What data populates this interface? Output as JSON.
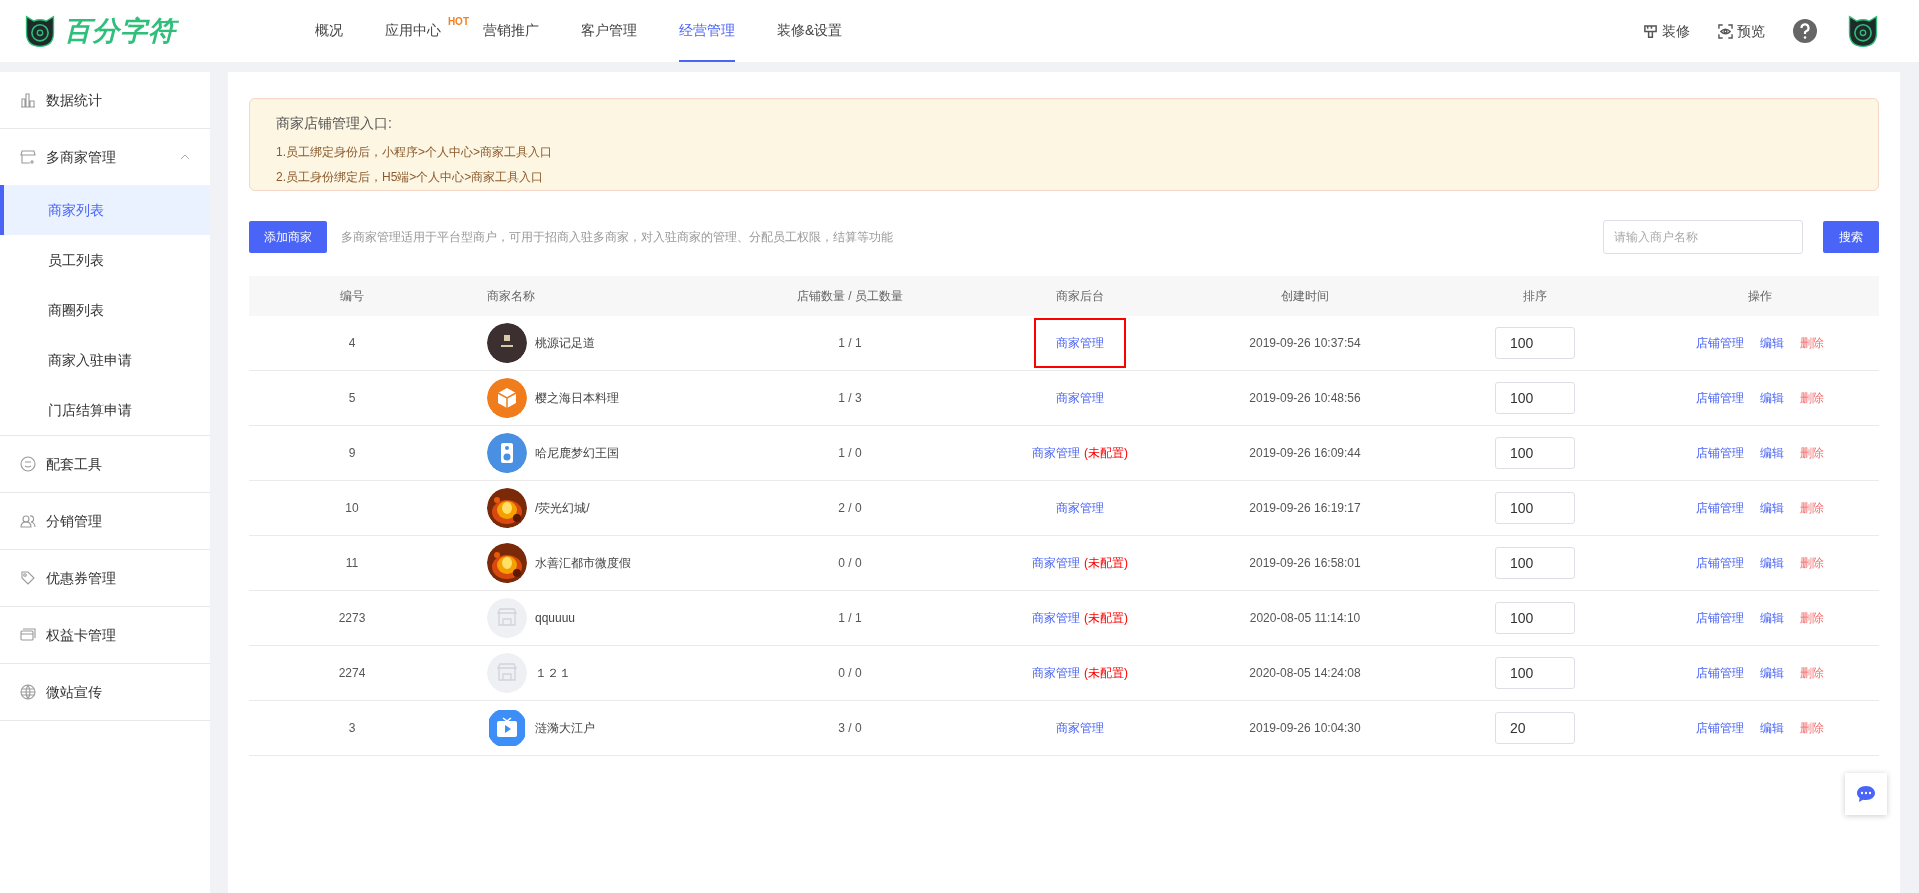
{
  "header": {
    "logo_text": "百分字符",
    "nav": [
      {
        "label": "概况",
        "selected": false
      },
      {
        "label": "应用中心",
        "badge": "HOT",
        "selected": false
      },
      {
        "label": "营销推广",
        "selected": false
      },
      {
        "label": "客户管理",
        "selected": false
      },
      {
        "label": "经营管理",
        "selected": true
      },
      {
        "label": "装修&设置",
        "selected": false
      }
    ],
    "actions": [
      {
        "kind": "decorate",
        "label": "装修"
      },
      {
        "kind": "preview",
        "label": "预览"
      }
    ]
  },
  "sidebar": {
    "items": [
      {
        "kind": "chart",
        "label": "数据统计"
      },
      {
        "kind": "store",
        "label": "多商家管理",
        "expanded": true,
        "children": [
          {
            "label": "商家列表",
            "selected": true
          },
          {
            "label": "员工列表",
            "selected": false
          },
          {
            "label": "商圈列表",
            "selected": false
          },
          {
            "label": "商家入驻申请",
            "selected": false
          },
          {
            "label": "门店结算申请",
            "selected": false
          }
        ]
      },
      {
        "kind": "smile",
        "label": "配套工具"
      },
      {
        "kind": "people",
        "label": "分销管理"
      },
      {
        "kind": "coupon",
        "label": "优惠券管理"
      },
      {
        "kind": "card",
        "label": "权益卡管理"
      },
      {
        "kind": "globe",
        "label": "微站宣传"
      }
    ]
  },
  "notice": {
    "title": "商家店铺管理入口:",
    "lines": [
      "1.员工绑定身份后，小程序>个人中心>商家工具入口",
      "2.员工身份绑定后，H5端>个人中心>商家工具入口"
    ]
  },
  "toolbar": {
    "add_button": "添加商家",
    "description": "多商家管理适用于平台型商户，可用于招商入驻多商家，对入驻商家的管理、分配员工权限，结算等功能",
    "search": {
      "placeholder": "请输入商户名称"
    },
    "search_button": "搜索"
  },
  "table": {
    "columns": [
      "编号",
      "商家名称",
      "店铺数量 / 员工数量",
      "商家后台",
      "创建时间",
      "排序",
      "操作"
    ],
    "rows": [
      {
        "id": "4",
        "kind": "logo",
        "name": "桃源记足道",
        "counts": "1 / 1",
        "backend": "商家管理",
        "highlighted": true,
        "created": "2019-09-26 10:37:54",
        "sort": "100",
        "actions": [
          "店铺管理",
          "编辑",
          "删除"
        ]
      },
      {
        "id": "5",
        "kind": "box",
        "name": "樱之海日本料理",
        "counts": "1 / 3",
        "backend": "商家管理",
        "highlighted": false,
        "created": "2019-09-26 10:48:56",
        "sort": "100",
        "actions": [
          "店铺管理",
          "编辑",
          "删除"
        ]
      },
      {
        "id": "9",
        "kind": "speaker",
        "name": "哈尼鹿梦幻王国",
        "counts": "1 / 0",
        "backend": "商家管理",
        "note": "(未配置)",
        "highlighted": false,
        "created": "2019-09-26 16:09:44",
        "sort": "100",
        "actions": [
          "店铺管理",
          "编辑",
          "删除"
        ]
      },
      {
        "id": "10",
        "kind": "picture",
        "name": "/荧光幻城/",
        "counts": "2 / 0",
        "backend": "商家管理",
        "highlighted": false,
        "created": "2019-09-26 16:19:17",
        "sort": "100",
        "actions": [
          "店铺管理",
          "编辑",
          "删除"
        ]
      },
      {
        "id": "11",
        "kind": "picture",
        "name": "水善汇都市微度假",
        "counts": "0 / 0",
        "backend": "商家管理",
        "note": "(未配置)",
        "highlighted": false,
        "created": "2019-09-26 16:58:01",
        "sort": "100",
        "actions": [
          "店铺管理",
          "编辑",
          "删除"
        ]
      },
      {
        "id": "2273",
        "kind": "placeholder",
        "name": "qquuuu",
        "counts": "1 / 1",
        "backend": "商家管理",
        "note": "(未配置)",
        "highlighted": false,
        "created": "2020-08-05 11:14:10",
        "sort": "100",
        "actions": [
          "店铺管理",
          "编辑",
          "删除"
        ]
      },
      {
        "id": "2274",
        "kind": "placeholder",
        "name": "１２１",
        "counts": "0 / 0",
        "backend": "商家管理",
        "note": "(未配置)",
        "highlighted": false,
        "created": "2020-08-05 14:24:08",
        "sort": "100",
        "actions": [
          "店铺管理",
          "编辑",
          "删除"
        ]
      },
      {
        "id": "3",
        "kind": "video",
        "name": "涟漪大江户",
        "counts": "3 / 0",
        "backend": "商家管理",
        "highlighted": false,
        "created": "2019-09-26 10:04:30",
        "sort": "20",
        "actions": [
          "店铺管理",
          "编辑",
          "删除"
        ]
      }
    ]
  }
}
